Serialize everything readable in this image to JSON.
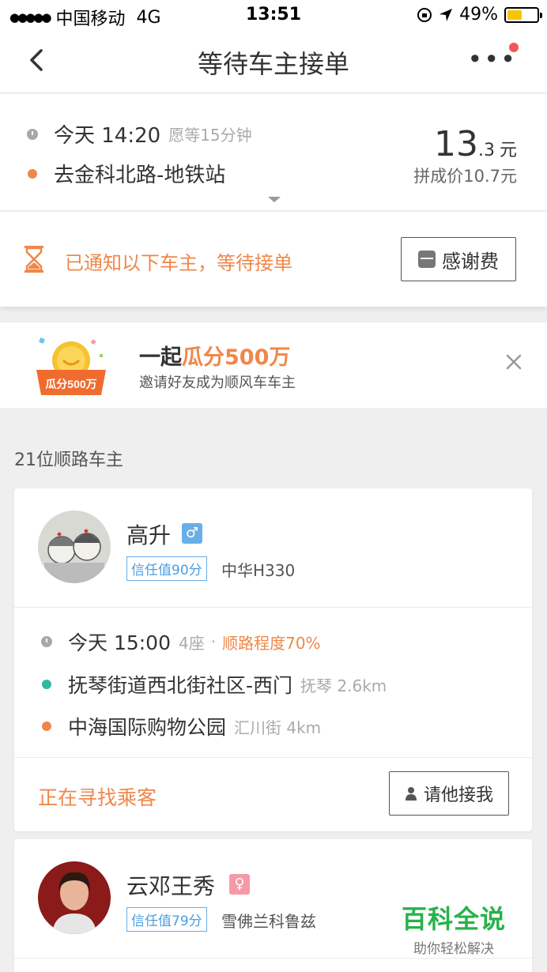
{
  "status_bar": {
    "signal": "●●●●●",
    "carrier": "中国移动",
    "network": "4G",
    "time": "13:51",
    "battery_percent": "49%",
    "battery_level": 0.49
  },
  "nav": {
    "title": "等待车主接单",
    "has_notification": true
  },
  "trip": {
    "time": "今天 14:20",
    "wait_note": "愿等15分钟",
    "destination": "去金科北路-地铁站",
    "price_int": "13",
    "price_dec": ".3",
    "price_unit": "元",
    "carpool_price": "拼成价10.7元"
  },
  "notify": {
    "text": "已通知以下车主，等待接单",
    "thanks_button": "感谢费"
  },
  "promo": {
    "badge_text": "瓜分500万",
    "title_prefix": "一起",
    "title_highlight": "瓜分500万",
    "subtitle": "邀请好友成为顺风车车主"
  },
  "drivers_header": "21位顺路车主",
  "drivers": [
    {
      "name": "高升",
      "gender": "♂",
      "trust": "信任值90分",
      "car": "中华H330",
      "time": "今天 15:00",
      "seats": "4座",
      "separator": "·",
      "match": "顺路程度70%",
      "start": "抚琴街道西北街社区-西门",
      "start_area": "抚琴 2.6km",
      "end": "中海国际购物公园",
      "end_area": "汇川街 4km",
      "status": "正在寻找乘客",
      "action": "请他接我"
    },
    {
      "name": "云邓王秀",
      "gender": "♀",
      "trust": "信任值79分",
      "car": "雪佛兰科鲁兹"
    }
  ],
  "watermark": {
    "title": "百科全说",
    "subtitle": "助你轻松解决"
  },
  "colors": {
    "accent_orange": "#f0874a",
    "trust_blue": "#4a9ee0",
    "route_teal": "#2fb9a0",
    "watermark_green": "#27b34a"
  }
}
